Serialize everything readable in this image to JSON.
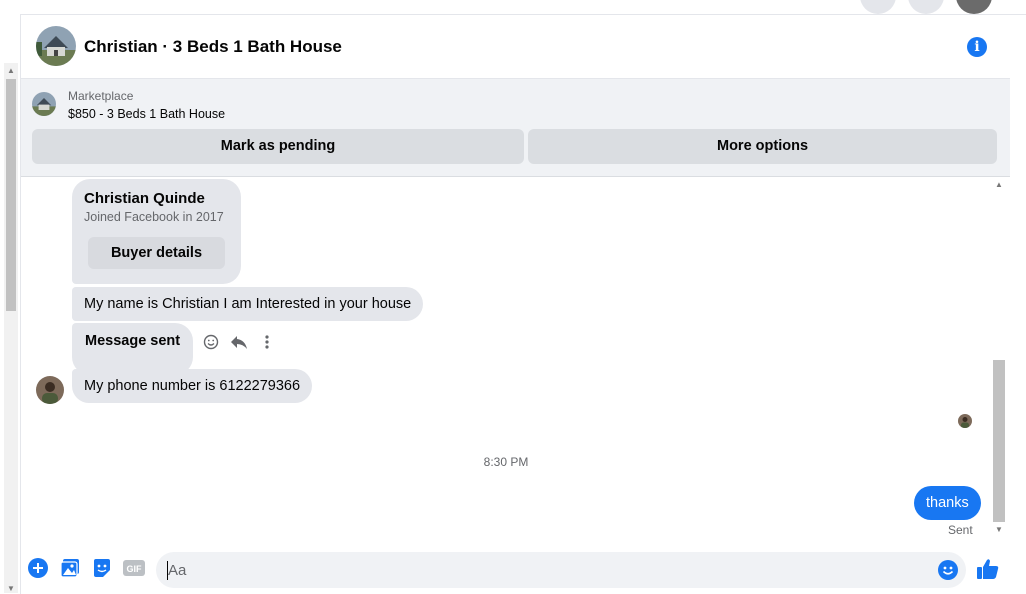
{
  "header": {
    "title": "Christian · 3 Beds 1 Bath House"
  },
  "marketplace": {
    "label": "Marketplace",
    "listing": "$850 - 3 Beds 1 Bath House",
    "mark_pending": "Mark as pending",
    "more_options": "More options"
  },
  "messages": {
    "buyer_name": "Christian Quinde",
    "joined": "Joined Facebook in 2017",
    "buyer_details": "Buyer details",
    "msg1": "My name is Christian I am Interested in your house",
    "msg2": "Message sent",
    "msg3": "My phone number is 6122279366",
    "timestamp": "8:30 PM",
    "my_msg": "thanks",
    "status": "Sent"
  },
  "composer": {
    "placeholder": "Aa",
    "icons": [
      "plus-icon",
      "photo-icon",
      "sticker-icon",
      "gif-icon",
      "emoji-icon",
      "like-icon"
    ],
    "gif_label": "GIF"
  },
  "colors": {
    "accent": "#1877f2",
    "bubble": "#e4e6eb",
    "panel": "#f0f2f5"
  }
}
